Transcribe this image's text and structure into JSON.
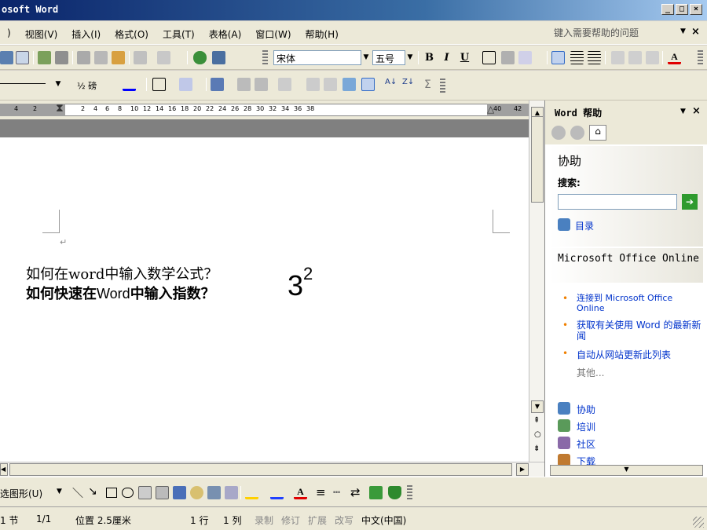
{
  "window": {
    "title": "osoft Word"
  },
  "menu": {
    "items": [
      ")",
      "视图(V)",
      "插入(I)",
      "格式(O)",
      "工具(T)",
      "表格(A)",
      "窗口(W)",
      "帮助(H)"
    ],
    "help_placeholder": "键入需要帮助的问题"
  },
  "format_toolbar": {
    "font": "宋体",
    "size": "五号",
    "bold": "B",
    "italic": "I",
    "underline": "U"
  },
  "table_toolbar": {
    "line_weight": "½ 磅",
    "sum": "Σ"
  },
  "ruler": {
    "numbers": [
      "4",
      "2",
      "2",
      "4",
      "6",
      "8",
      "10",
      "12",
      "14",
      "16",
      "18",
      "20",
      "22",
      "24",
      "26",
      "28",
      "30",
      "32",
      "34",
      "36",
      "38",
      "40",
      "42"
    ]
  },
  "document": {
    "line1": "如何在word中输入数学公式？",
    "line2_a": "如何快速在",
    "line2_b": "Word",
    "line2_c": "中输入指数？",
    "base": "3",
    "exponent": "2",
    "para_mark": "↵"
  },
  "taskpane": {
    "title": "Word 帮助",
    "assist_title": "协助",
    "search_label": "搜索:",
    "toc_link": "目录",
    "online_title": "Microsoft Office Online",
    "bullets": [
      "连接到 Microsoft Office Online",
      "获取有关使用 Word 的最新新闻",
      "自动从网站更新此列表"
    ],
    "more": "其他...",
    "bottom_links": [
      "协助",
      "培训",
      "社区",
      "下载"
    ]
  },
  "drawing": {
    "select_objects": "选图形(U)"
  },
  "status": {
    "section": "1 节",
    "page": "1/1",
    "position": "位置 2.5厘米",
    "line": "1 行",
    "column": "1 列",
    "rec": "录制",
    "trk": "修订",
    "ext": "扩展",
    "ovr": "改写",
    "lang": "中文(中国)"
  }
}
